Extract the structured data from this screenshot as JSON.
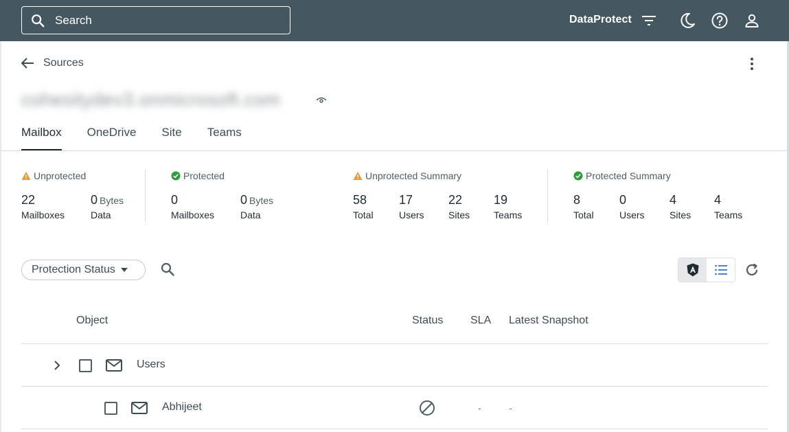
{
  "topbar": {
    "search_placeholder": "Search",
    "app_name": "DataProtect",
    "icons": [
      "search-icon",
      "filter-lines-icon",
      "moon-icon",
      "help-icon",
      "user-icon"
    ]
  },
  "breadcrumb": {
    "label": "Sources"
  },
  "source": {
    "name": "cohesitydev3.onmicrosoft.com"
  },
  "tabs": [
    {
      "label": "Mailbox",
      "active": true
    },
    {
      "label": "OneDrive",
      "active": false
    },
    {
      "label": "Site",
      "active": false
    },
    {
      "label": "Teams",
      "active": false
    }
  ],
  "stats": {
    "unprotected": {
      "title": "Unprotected",
      "mailboxes_value": "22",
      "mailboxes_label": "Mailboxes",
      "data_value": "0",
      "data_unit": "Bytes",
      "data_label": "Data"
    },
    "protected": {
      "title": "Protected",
      "mailboxes_value": "0",
      "mailboxes_label": "Mailboxes",
      "data_value": "0",
      "data_unit": "Bytes",
      "data_label": "Data"
    },
    "unprotected_summary": {
      "title": "Unprotected Summary",
      "total_value": "58",
      "total_label": "Total",
      "users_value": "17",
      "users_label": "Users",
      "sites_value": "22",
      "sites_label": "Sites",
      "teams_value": "19",
      "teams_label": "Teams"
    },
    "protected_summary": {
      "title": "Protected Summary",
      "total_value": "8",
      "total_label": "Total",
      "users_value": "0",
      "users_label": "Users",
      "sites_value": "4",
      "sites_label": "Sites",
      "teams_value": "4",
      "teams_label": "Teams"
    }
  },
  "colors": {
    "topbar": "#455760",
    "warning": "#f0962e",
    "success": "#2e9d3c",
    "accent": "#2f6fc2"
  },
  "filter": {
    "label": "Protection Status"
  },
  "table": {
    "headers": {
      "object": "Object",
      "status": "Status",
      "sla": "SLA",
      "latest_snapshot": "Latest Snapshot"
    },
    "rows": [
      {
        "name": "Users",
        "status": "",
        "sla": "",
        "snapshot": ""
      },
      {
        "name": "Abhijeet",
        "status": "unprotected-icon",
        "sla": "-",
        "snapshot": "-"
      }
    ]
  }
}
